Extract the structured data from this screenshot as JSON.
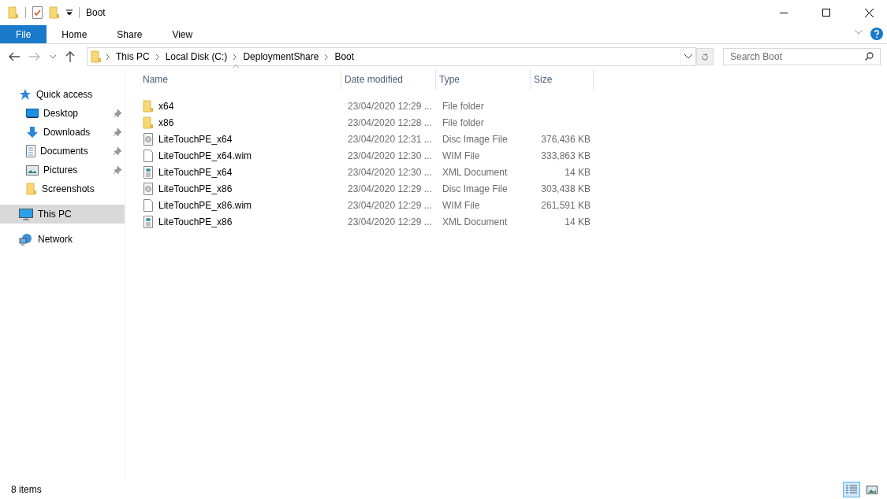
{
  "window": {
    "title": "Boot"
  },
  "ribbon": {
    "tabs": [
      {
        "label": "File",
        "selected": true
      },
      {
        "label": "Home",
        "selected": false
      },
      {
        "label": "Share",
        "selected": false
      },
      {
        "label": "View",
        "selected": false
      }
    ]
  },
  "address": {
    "path": [
      "This PC",
      "Local Disk (C:)",
      "DeploymentShare",
      "Boot"
    ]
  },
  "search": {
    "placeholder": "Search Boot"
  },
  "sidebar": {
    "items": [
      {
        "label": "Quick access",
        "kind": "star",
        "pinned": false,
        "selected": false,
        "children": [
          {
            "label": "Desktop",
            "kind": "desktop",
            "pinned": true,
            "selected": false
          },
          {
            "label": "Downloads",
            "kind": "download",
            "pinned": true,
            "selected": false
          },
          {
            "label": "Documents",
            "kind": "documents",
            "pinned": true,
            "selected": false
          },
          {
            "label": "Pictures",
            "kind": "pictures",
            "pinned": true,
            "selected": false
          },
          {
            "label": "Screenshots",
            "kind": "folder",
            "pinned": false,
            "selected": false
          }
        ]
      },
      {
        "label": "This PC",
        "kind": "pc",
        "pinned": false,
        "selected": true
      },
      {
        "label": "Network",
        "kind": "network",
        "pinned": false,
        "selected": false
      }
    ]
  },
  "table": {
    "columns": [
      "Name",
      "Date modified",
      "Type",
      "Size"
    ],
    "rows": [
      {
        "kind": "folder",
        "name": "x64",
        "date": "23/04/2020 12:29 ...",
        "type": "File folder"
      },
      {
        "kind": "folder",
        "name": "x86",
        "date": "23/04/2020 12:28 ...",
        "type": "File folder"
      },
      {
        "kind": "disc",
        "name": "LiteTouchPE_x64",
        "date": "23/04/2020 12:31 ...",
        "type": "Disc Image File",
        "size": "376,436 KB"
      },
      {
        "kind": "file",
        "name": "LiteTouchPE_x64.wim",
        "date": "23/04/2020 12:30 ...",
        "type": "WIM File",
        "size": "333,863 KB"
      },
      {
        "kind": "xml",
        "name": "LiteTouchPE_x64",
        "date": "23/04/2020 12:30 ...",
        "type": "XML Document",
        "size": "14 KB"
      },
      {
        "kind": "disc",
        "name": "LiteTouchPE_x86",
        "date": "23/04/2020 12:29 ...",
        "type": "Disc Image File",
        "size": "303,438 KB"
      },
      {
        "kind": "file",
        "name": "LiteTouchPE_x86.wim",
        "date": "23/04/2020 12:29 ...",
        "type": "WIM File",
        "size": "261,591 KB"
      },
      {
        "kind": "xml",
        "name": "LiteTouchPE_x86",
        "date": "23/04/2020 12:29 ...",
        "type": "XML Document",
        "size": "14 KB"
      }
    ]
  },
  "status_bar": {
    "count": "8 items",
    "views": [
      {
        "kind": "details",
        "selected": true
      },
      {
        "kind": "large",
        "selected": false
      }
    ]
  }
}
